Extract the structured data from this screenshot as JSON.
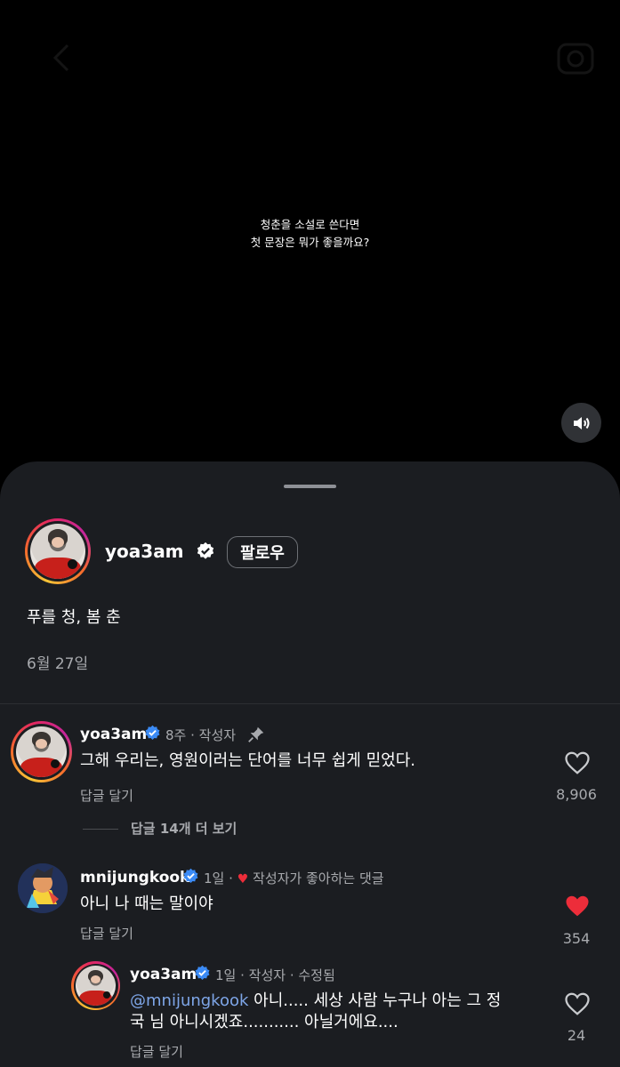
{
  "video": {
    "caption_line1": "청춘을 소설로 쓴다면",
    "caption_line2": "첫 문장은 뭐가 좋을까요?",
    "icons": [
      "back-arrow-icon",
      "camera-icon",
      "speaker-icon"
    ]
  },
  "post": {
    "username": "yoa3am",
    "follow_label": "팔로우",
    "body": "푸를 청, 봄 춘",
    "date": "6월 27일"
  },
  "comments": [
    {
      "username": "yoa3am",
      "time": "8주",
      "author_tag": "· 작성자",
      "text": "그해 우리는, 영원이러는 단어를 너무 쉽게 믿었다.",
      "reply_label": "답글 달기",
      "likes": "8,906",
      "more_replies": "답글 14개 더 보기"
    },
    {
      "username": "mnijungkook",
      "time": "1일",
      "dot": "·",
      "liked_by_author": "작성자가 좋아하는 댓글",
      "text": "아니 나 때는 말이야",
      "reply_label": "답글 달기",
      "likes": "354"
    },
    {
      "username": "yoa3am",
      "time": "1일",
      "author_tag": "· 작성자 · 수정됨",
      "mention": "@mnijungkook",
      "text_line1": " 아니..... 세상 사람 누구나 아는 그 정",
      "text_line2": "국 님 아니시겠죠........... 아닐거에요....",
      "reply_label": "답글 달기",
      "likes": "24"
    }
  ],
  "colors": {
    "sheet_bg": "#1b1d21",
    "verified_blue": "#3b8bf6",
    "like_red": "#ed2d3a",
    "mention_blue": "#7ea6e8",
    "muted_text": "#a8aaae"
  }
}
